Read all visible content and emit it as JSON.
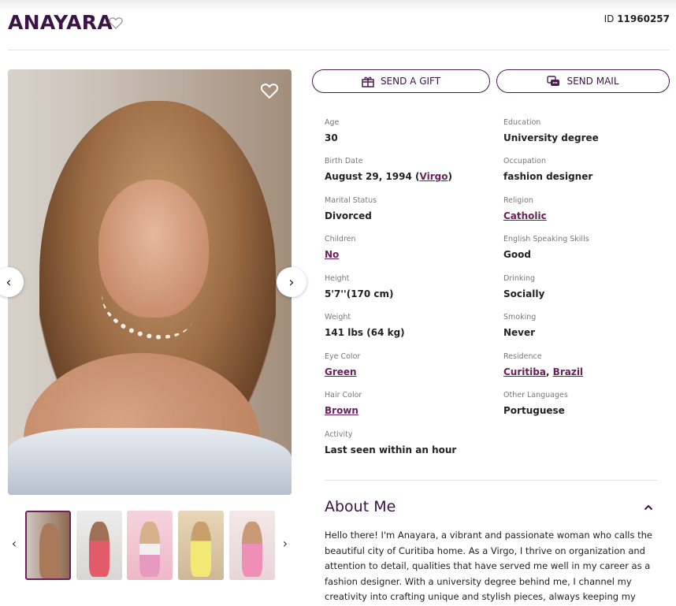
{
  "profile": {
    "name": "ANAYARA",
    "id_label": "ID",
    "id_value": "11960257"
  },
  "actions": {
    "gift_label": "SEND A GIFT",
    "mail_label": "SEND MAIL"
  },
  "details": {
    "age": {
      "label": "Age",
      "value": "30"
    },
    "education": {
      "label": "Education",
      "value": "University degree"
    },
    "birth_date": {
      "label": "Birth Date",
      "value": "August 29, 1994 (",
      "sign": "Virgo",
      "close": ")"
    },
    "occupation": {
      "label": "Occupation",
      "value": "fashion designer"
    },
    "marital_status": {
      "label": "Marital Status",
      "value": "Divorced"
    },
    "religion": {
      "label": "Religion",
      "value": "Catholic"
    },
    "children": {
      "label": "Children",
      "value": "No"
    },
    "english": {
      "label": "English Speaking Skills",
      "value": "Good"
    },
    "height": {
      "label": "Height",
      "value": "5'7''(170 cm)"
    },
    "drinking": {
      "label": "Drinking",
      "value": "Socially"
    },
    "weight": {
      "label": "Weight",
      "value": "141 lbs (64 kg)"
    },
    "smoking": {
      "label": "Smoking",
      "value": "Never"
    },
    "eye_color": {
      "label": "Eye Color",
      "value": "Green"
    },
    "residence": {
      "label": "Residence",
      "city": "Curitiba",
      "sep": ", ",
      "country": "Brazil"
    },
    "hair_color": {
      "label": "Hair Color",
      "value": "Brown"
    },
    "other_languages": {
      "label": "Other Languages",
      "value": "Portuguese"
    },
    "activity": {
      "label": "Activity",
      "value": "Last seen within an hour"
    }
  },
  "about": {
    "title": "About Me",
    "text": "Hello there! I'm Anayara, a vibrant and passionate woman who calls the beautiful city of Curitiba home. As a Virgo, I thrive on organization and attention to detail, qualities that have served me well in my career as a fashion designer. With a university degree behind me, I channel my creativity into crafting unique and stylish pieces, always keeping my clients'"
  },
  "icons": {
    "favorite": "heart-outline-icon",
    "gift": "gift-icon",
    "mail": "chat-mail-icon",
    "prev": "chevron-left-icon",
    "next": "chevron-right-icon",
    "collapse": "chevron-up-icon"
  },
  "colors": {
    "brand": "#3a1446",
    "link": "#6b1f5c",
    "thumb_border": "#6b1f5c"
  }
}
